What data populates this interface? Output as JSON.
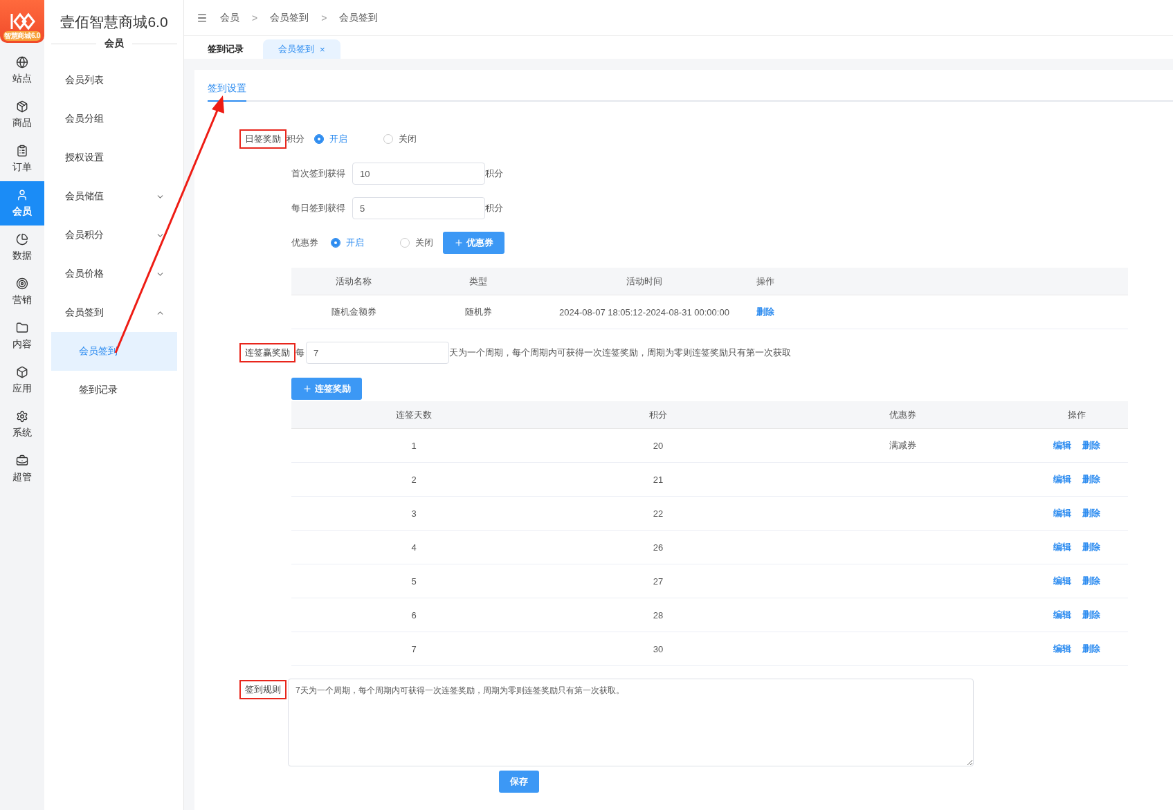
{
  "logo": {
    "caption": "智慧商城6.0"
  },
  "rail": [
    {
      "label": "站点",
      "selected": false
    },
    {
      "label": "商品",
      "selected": false
    },
    {
      "label": "订单",
      "selected": false
    },
    {
      "label": "会员",
      "selected": true
    },
    {
      "label": "数据",
      "selected": false
    },
    {
      "label": "营销",
      "selected": false
    },
    {
      "label": "内容",
      "selected": false
    },
    {
      "label": "应用",
      "selected": false
    },
    {
      "label": "系统",
      "selected": false
    },
    {
      "label": "超管",
      "selected": false
    }
  ],
  "sidebar": {
    "title": "壹佰智慧商城6.0",
    "section": "会员",
    "items": [
      {
        "kind": "link",
        "label": "会员列表"
      },
      {
        "kind": "link",
        "label": "会员分组"
      },
      {
        "kind": "link",
        "label": "授权设置"
      },
      {
        "kind": "group",
        "label": "会员储值",
        "expanded": false
      },
      {
        "kind": "group",
        "label": "会员积分",
        "expanded": false
      },
      {
        "kind": "group",
        "label": "会员价格",
        "expanded": false
      },
      {
        "kind": "group",
        "label": "会员签到",
        "expanded": true,
        "children": [
          {
            "label": "会员签到",
            "selected": true
          },
          {
            "label": "签到记录",
            "selected": false
          }
        ]
      }
    ]
  },
  "breadcrumbs": {
    "separator": ">",
    "items": [
      "会员",
      "会员签到",
      "会员签到"
    ]
  },
  "tabs": [
    {
      "label": "签到记录",
      "selected": false
    },
    {
      "label": "会员签到",
      "selected": true,
      "close": "×"
    }
  ],
  "sub_tabs": [
    {
      "label": "签到设置",
      "selected": true
    }
  ],
  "daily": {
    "label": "日签奖励",
    "highlighted": true,
    "points_label": "积分",
    "options": [
      {
        "label": "开启",
        "selected": true
      },
      {
        "label": "关闭",
        "selected": false
      }
    ],
    "fields": [
      {
        "label": "首次签到获得",
        "value": "10",
        "unit": "积分"
      },
      {
        "label": "每日签到获得",
        "value": "5",
        "unit": "积分"
      }
    ],
    "coupon": {
      "label": "优惠券",
      "options": [
        {
          "label": "开启",
          "selected": true
        },
        {
          "label": "关闭",
          "selected": false
        }
      ],
      "add_button": "优惠券",
      "columns": [
        "活动名称",
        "类型",
        "活动时间",
        "操作"
      ],
      "rows": [
        {
          "name": "随机金额券",
          "type": "随机券",
          "time": "2024-08-07 18:05:12-2024-08-31 00:00:00",
          "action": "删除"
        }
      ]
    }
  },
  "streak": {
    "label": "连签赢奖励",
    "highlighted": true,
    "prefix": "每",
    "value": "7",
    "suffix": "天为一个周期，每个周期内可获得一次连签奖励，周期为零则连签奖励只有第一次获取",
    "add_button": "连签奖励",
    "columns": [
      "连签天数",
      "积分",
      "优惠券",
      "操作"
    ],
    "rows": [
      {
        "days": "1",
        "points": "20",
        "coupon": "满减券",
        "actions": [
          "编辑",
          "删除"
        ]
      },
      {
        "days": "2",
        "points": "21",
        "actions": [
          "编辑",
          "删除"
        ]
      },
      {
        "days": "3",
        "points": "22",
        "actions": [
          "编辑",
          "删除"
        ]
      },
      {
        "days": "4",
        "points": "26",
        "actions": [
          "编辑",
          "删除"
        ]
      },
      {
        "days": "5",
        "points": "27",
        "actions": [
          "编辑",
          "删除"
        ]
      },
      {
        "days": "6",
        "points": "28",
        "actions": [
          "编辑",
          "删除"
        ]
      },
      {
        "days": "7",
        "points": "30",
        "actions": [
          "编辑",
          "删除"
        ]
      }
    ]
  },
  "rules": {
    "label": "签到规则",
    "highlighted": true,
    "value": "7天为一个周期，每个周期内可获得一次连签奖励，周期为零则连签奖励只有第一次获取。"
  },
  "save_button": "保存"
}
